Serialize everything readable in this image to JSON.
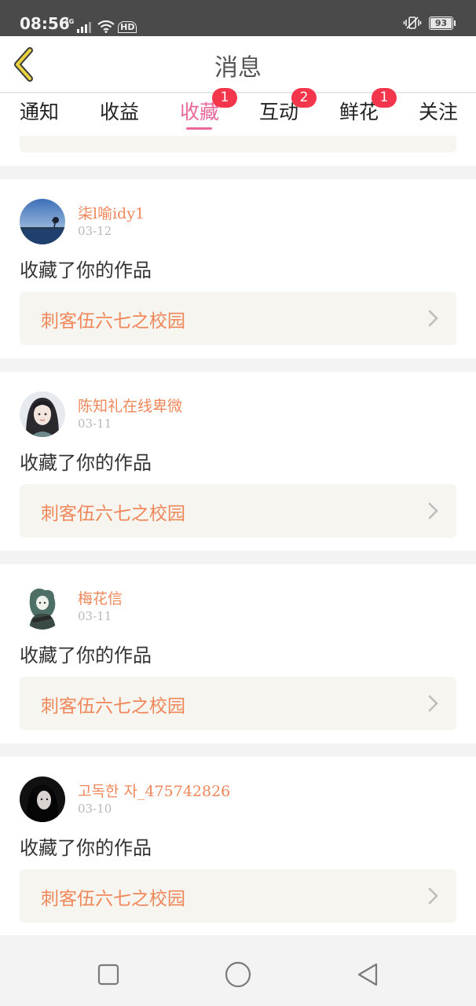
{
  "status_bar": {
    "time": "08:56",
    "network": "4G",
    "hd": "HD",
    "battery": "93"
  },
  "header": {
    "title": "消息",
    "back_icon": "chevron-left-icon"
  },
  "tabs": [
    {
      "label": "通知",
      "badge": "",
      "active": false
    },
    {
      "label": "收益",
      "badge": "",
      "active": false
    },
    {
      "label": "收藏",
      "badge": "1",
      "active": true
    },
    {
      "label": "互动",
      "badge": "2",
      "active": false
    },
    {
      "label": "鲜花",
      "badge": "1",
      "active": false
    },
    {
      "label": "关注",
      "badge": "",
      "active": false
    }
  ],
  "messages": [
    {
      "username": "柒l喻idy1",
      "date": "03-12",
      "action": "收藏了你的作品",
      "work_title": "刺客伍六七之校园"
    },
    {
      "username": "陈知礼在线卑微",
      "date": "03-11",
      "action": "收藏了你的作品",
      "work_title": "刺客伍六七之校园"
    },
    {
      "username": "梅花信",
      "date": "03-11",
      "action": "收藏了你的作品",
      "work_title": "刺客伍六七之校园"
    },
    {
      "username": "고독한 자_475742826",
      "date": "03-10",
      "action": "收藏了你的作品",
      "work_title": "刺客伍六七之校园"
    }
  ],
  "colors": {
    "accent_pink": "#e9689b",
    "badge_red": "#f4364c",
    "username_orange": "#f0875a",
    "link_bg": "#f6f5ef",
    "back_icon_yellow": "#e8d23f"
  },
  "nav": {
    "recent_icon": "square-icon",
    "home_icon": "circle-icon",
    "back_icon": "triangle-back-icon"
  }
}
